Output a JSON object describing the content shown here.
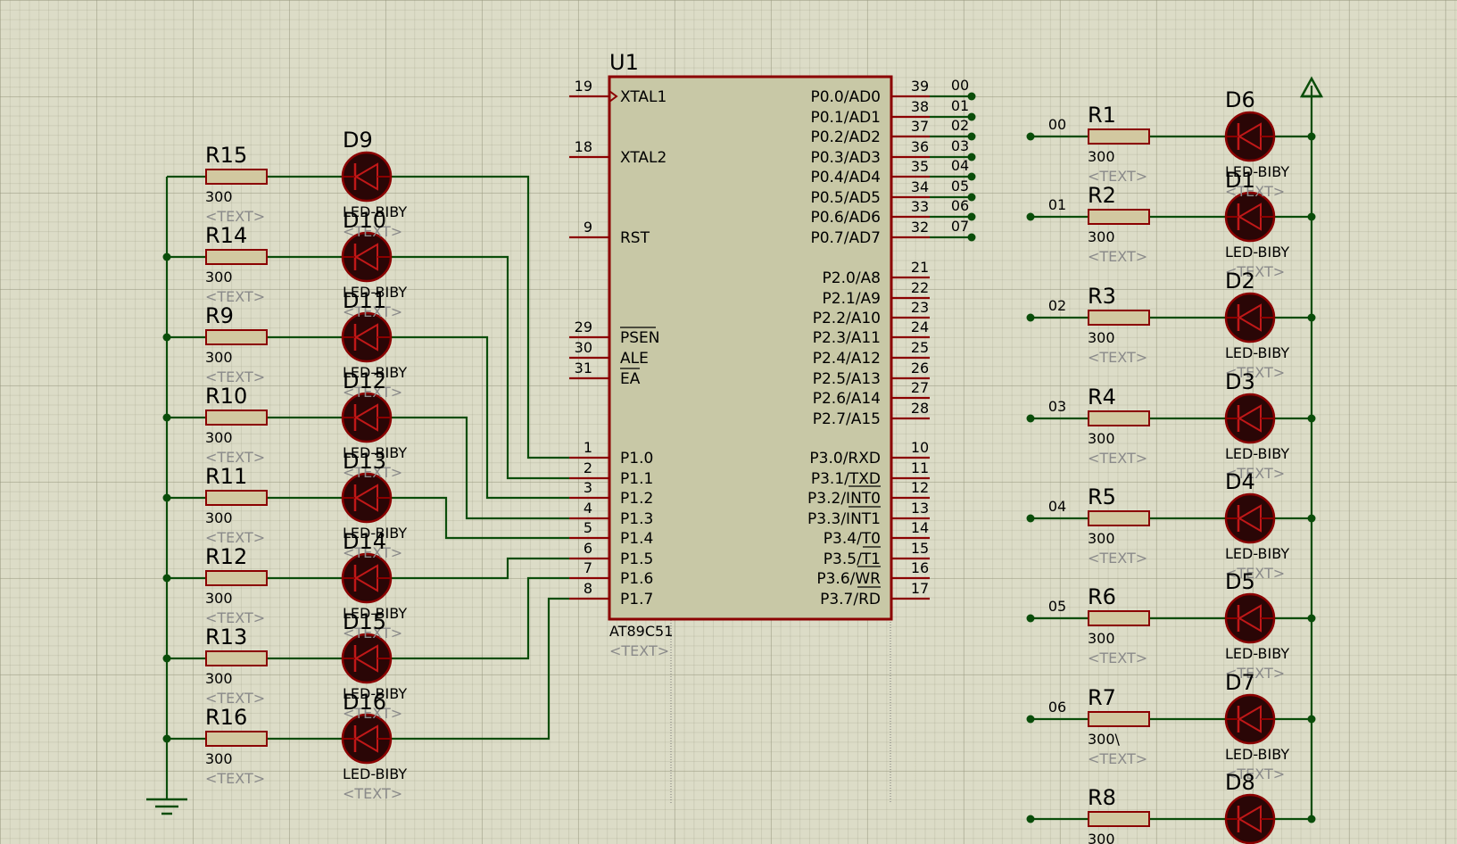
{
  "chip": {
    "ref": "U1",
    "part": "AT89C51",
    "text": "<TEXT>",
    "left_pins": [
      {
        "num": "19",
        "name": "XTAL1"
      },
      {
        "num": "18",
        "name": "XTAL2"
      },
      {
        "num": "9",
        "name": "RST"
      },
      {
        "num": "29",
        "name": "PSEN"
      },
      {
        "num": "30",
        "name": "ALE"
      },
      {
        "num": "31",
        "name": "EA"
      },
      {
        "num": "1",
        "name": "P1.0"
      },
      {
        "num": "2",
        "name": "P1.1"
      },
      {
        "num": "3",
        "name": "P1.2"
      },
      {
        "num": "4",
        "name": "P1.3"
      },
      {
        "num": "5",
        "name": "P1.4"
      },
      {
        "num": "6",
        "name": "P1.5"
      },
      {
        "num": "7",
        "name": "P1.6"
      },
      {
        "num": "8",
        "name": "P1.7"
      }
    ],
    "right_pins": [
      {
        "num": "39",
        "name": "P0.0/AD0"
      },
      {
        "num": "38",
        "name": "P0.1/AD1"
      },
      {
        "num": "37",
        "name": "P0.2/AD2"
      },
      {
        "num": "36",
        "name": "P0.3/AD3"
      },
      {
        "num": "35",
        "name": "P0.4/AD4"
      },
      {
        "num": "34",
        "name": "P0.5/AD5"
      },
      {
        "num": "33",
        "name": "P0.6/AD6"
      },
      {
        "num": "32",
        "name": "P0.7/AD7"
      },
      {
        "num": "21",
        "name": "P2.0/A8"
      },
      {
        "num": "22",
        "name": "P2.1/A9"
      },
      {
        "num": "23",
        "name": "P2.2/A10"
      },
      {
        "num": "24",
        "name": "P2.3/A11"
      },
      {
        "num": "25",
        "name": "P2.4/A12"
      },
      {
        "num": "26",
        "name": "P2.5/A13"
      },
      {
        "num": "27",
        "name": "P2.6/A14"
      },
      {
        "num": "28",
        "name": "P2.7/A15"
      },
      {
        "num": "10",
        "name": "P3.0/RXD"
      },
      {
        "num": "11",
        "name": "P3.1/TXD"
      },
      {
        "num": "12",
        "name": "P3.2/INT0"
      },
      {
        "num": "13",
        "name": "P3.3/INT1"
      },
      {
        "num": "14",
        "name": "P3.4/T0"
      },
      {
        "num": "15",
        "name": "P3.5/T1"
      },
      {
        "num": "16",
        "name": "P3.6/WR"
      },
      {
        "num": "17",
        "name": "P3.7/RD"
      }
    ],
    "bus_labels": [
      "00",
      "01",
      "02",
      "03",
      "04",
      "05",
      "06",
      "07"
    ]
  },
  "left_bank": [
    {
      "r": "R15",
      "rv": "300",
      "rt": "<TEXT>",
      "d": "D9",
      "dv": "LED-BIBY",
      "dt": "<TEXT>"
    },
    {
      "r": "R14",
      "rv": "300",
      "rt": "<TEXT>",
      "d": "D10",
      "dv": "LED-BIBY",
      "dt": "<TEXT>"
    },
    {
      "r": "R9",
      "rv": "300",
      "rt": "<TEXT>",
      "d": "D11",
      "dv": "LED-BIBY",
      "dt": "<TEXT>"
    },
    {
      "r": "R10",
      "rv": "300",
      "rt": "<TEXT>",
      "d": "D12",
      "dv": "LED-BIBY",
      "dt": "<TEXT>"
    },
    {
      "r": "R11",
      "rv": "300",
      "rt": "<TEXT>",
      "d": "D13",
      "dv": "LED-BIBY",
      "dt": "<TEXT>"
    },
    {
      "r": "R12",
      "rv": "300",
      "rt": "<TEXT>",
      "d": "D14",
      "dv": "LED-BIBY",
      "dt": "<TEXT>"
    },
    {
      "r": "R13",
      "rv": "300",
      "rt": "<TEXT>",
      "d": "D15",
      "dv": "LED-BIBY",
      "dt": "<TEXT>"
    },
    {
      "r": "R16",
      "rv": "300",
      "rt": "<TEXT>",
      "d": "D16",
      "dv": "LED-BIBY",
      "dt": "<TEXT>"
    }
  ],
  "right_bank": [
    {
      "net": "00",
      "r": "R1",
      "rv": "300",
      "rt": "<TEXT>",
      "d": "D6",
      "dv": "LED-BIBY",
      "dt": "<TEXT>"
    },
    {
      "net": "01",
      "r": "R2",
      "rv": "300",
      "rt": "<TEXT>",
      "d": "D1",
      "dv": "LED-BIBY",
      "dt": "<TEXT>"
    },
    {
      "net": "02",
      "r": "R3",
      "rv": "300",
      "rt": "<TEXT>",
      "d": "D2",
      "dv": "LED-BIBY",
      "dt": "<TEXT>"
    },
    {
      "net": "03",
      "r": "R4",
      "rv": "300",
      "rt": "<TEXT>",
      "d": "D3",
      "dv": "LED-BIBY",
      "dt": "<TEXT>"
    },
    {
      "net": "04",
      "r": "R5",
      "rv": "300",
      "rt": "<TEXT>",
      "d": "D4",
      "dv": "LED-BIBY",
      "dt": "<TEXT>"
    },
    {
      "net": "05",
      "r": "R6",
      "rv": "300",
      "rt": "<TEXT>",
      "d": "D5",
      "dv": "LED-BIBY",
      "dt": "<TEXT>"
    },
    {
      "net": "06",
      "r": "R7",
      "rv": "300\\",
      "rt": "<TEXT>",
      "d": "D7",
      "dv": "LED-BIBY",
      "dt": "<TEXT>"
    },
    {
      "net": "",
      "r": "R8",
      "rv": "300",
      "rt": "",
      "d": "D8",
      "dv": "",
      "dt": ""
    }
  ],
  "colors": {
    "wire": "#0a4d0a",
    "component": "#8b0000",
    "resistor_fill": "#d2c8a0",
    "chip_fill": "#c8c8a6",
    "led_fill": "#2a0606",
    "label": "#000000",
    "placeholder": "#8a8a8a"
  }
}
